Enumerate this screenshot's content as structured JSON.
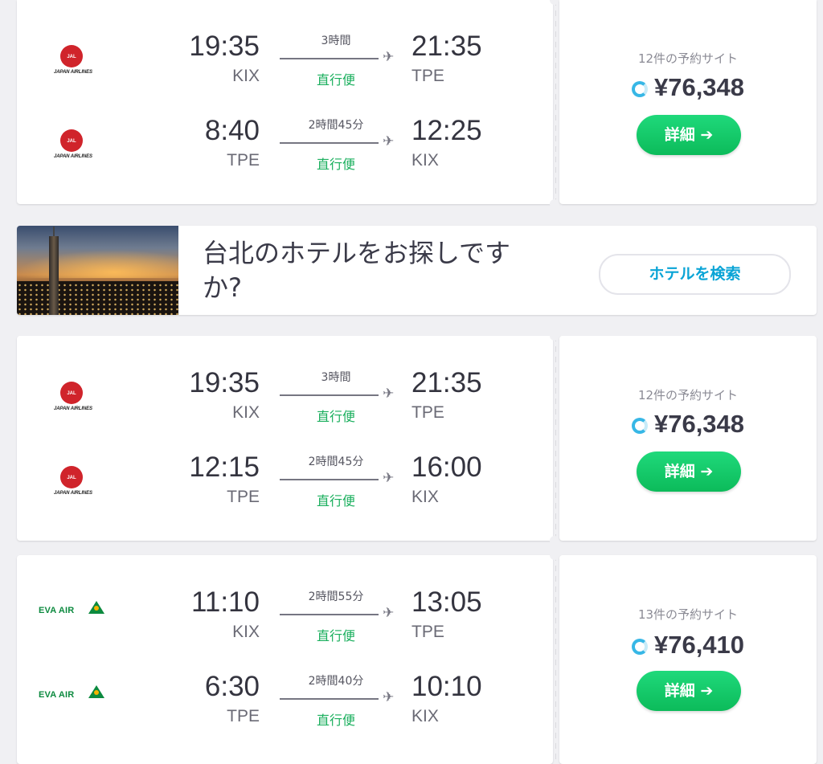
{
  "results": [
    {
      "legs": [
        {
          "airline": "JAL",
          "airline_name": "JAPAN AIRLINES",
          "dep_time": "19:35",
          "dep_code": "KIX",
          "duration": "3時間",
          "stops": "直行便",
          "arr_time": "21:35",
          "arr_code": "TPE"
        },
        {
          "airline": "JAL",
          "airline_name": "JAPAN AIRLINES",
          "dep_time": "8:40",
          "dep_code": "TPE",
          "duration": "2時間45分",
          "stops": "直行便",
          "arr_time": "12:25",
          "arr_code": "KIX"
        }
      ],
      "sites": "12件の予約サイト",
      "price": "¥76,348",
      "button": "詳細 ➔"
    },
    {
      "legs": [
        {
          "airline": "JAL",
          "airline_name": "JAPAN AIRLINES",
          "dep_time": "19:35",
          "dep_code": "KIX",
          "duration": "3時間",
          "stops": "直行便",
          "arr_time": "21:35",
          "arr_code": "TPE"
        },
        {
          "airline": "JAL",
          "airline_name": "JAPAN AIRLINES",
          "dep_time": "12:15",
          "dep_code": "TPE",
          "duration": "2時間45分",
          "stops": "直行便",
          "arr_time": "16:00",
          "arr_code": "KIX"
        }
      ],
      "sites": "12件の予約サイト",
      "price": "¥76,348",
      "button": "詳細 ➔"
    },
    {
      "legs": [
        {
          "airline": "EVA",
          "airline_name": "EVA AIR",
          "dep_time": "11:10",
          "dep_code": "KIX",
          "duration": "2時間55分",
          "stops": "直行便",
          "arr_time": "13:05",
          "arr_code": "TPE"
        },
        {
          "airline": "EVA",
          "airline_name": "EVA AIR",
          "dep_time": "6:30",
          "dep_code": "TPE",
          "duration": "2時間40分",
          "stops": "直行便",
          "arr_time": "10:10",
          "arr_code": "KIX"
        }
      ],
      "sites": "13件の予約サイト",
      "price": "¥76,410",
      "button": "詳細 ➔"
    }
  ],
  "hotel_banner": {
    "text": "台北のホテルをお探しですか?",
    "button": "ホテルを検索"
  },
  "colors": {
    "accent_green": "#1aaf5d",
    "hotel_blue": "#0aa4d6",
    "jal_red": "#d0242b",
    "eva_green": "#0c8a3f"
  }
}
